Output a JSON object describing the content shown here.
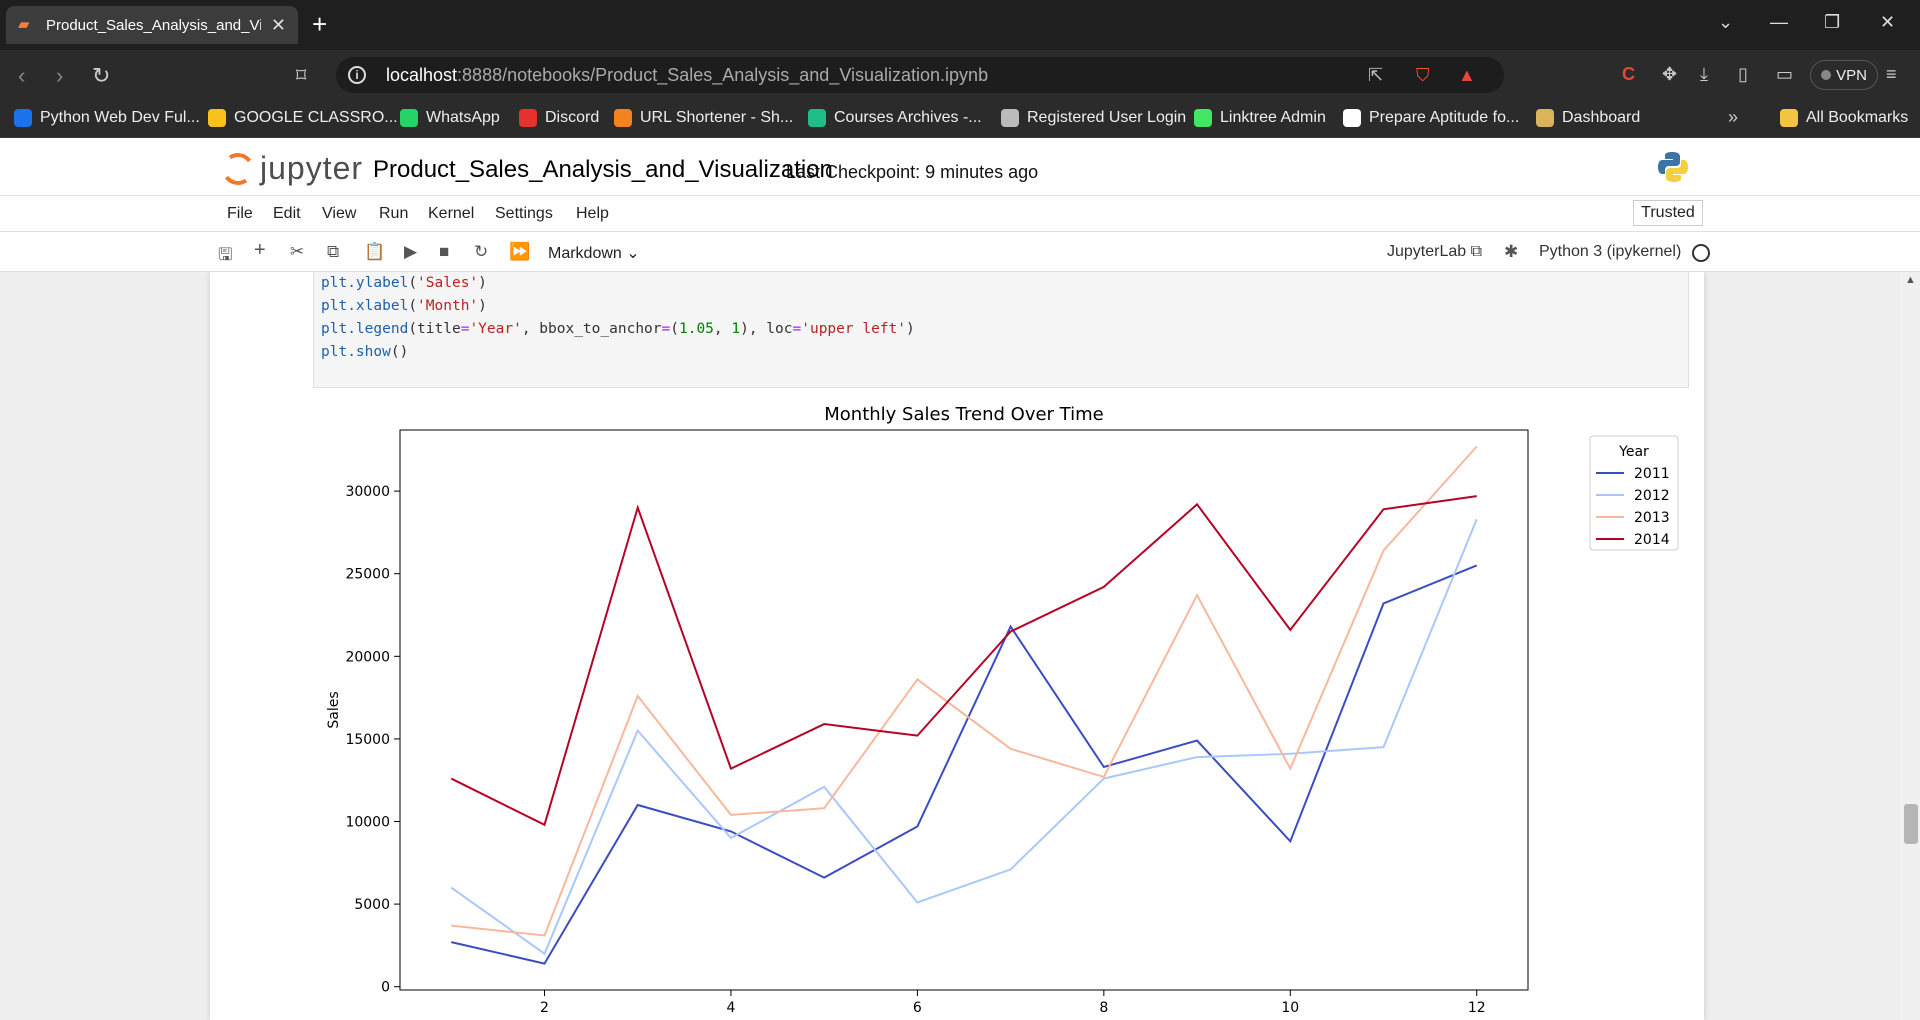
{
  "browser": {
    "tab_title": "Product_Sales_Analysis_and_Vis",
    "url_host": "localhost",
    "url_rest": ":8888/notebooks/Product_Sales_Analysis_and_Visualization.ipynb",
    "vpn_label": "VPN",
    "bookmarks": [
      {
        "label": "Python Web Dev Ful...",
        "icon": "code-icon",
        "color": "#1a73e8"
      },
      {
        "label": "GOOGLE CLASSRO...",
        "icon": "classroom-icon",
        "color": "#f9c11a"
      },
      {
        "label": "WhatsApp",
        "icon": "whatsapp-icon",
        "color": "#25d366"
      },
      {
        "label": "Discord",
        "icon": "discord-icon",
        "color": "#e5322d"
      },
      {
        "label": "URL Shortener - Sh...",
        "icon": "link-icon",
        "color": "#f58220"
      },
      {
        "label": "Courses Archives -...",
        "icon": "courses-icon",
        "color": "#1fbd8a"
      },
      {
        "label": "Registered User Login",
        "icon": "globe-icon",
        "color": "#bbbbbb"
      },
      {
        "label": "Linktree Admin",
        "icon": "linktree-icon",
        "color": "#43e660"
      },
      {
        "label": "Prepare Aptitude fo...",
        "icon": "check-icon",
        "color": "#ffffff"
      },
      {
        "label": "Dashboard",
        "icon": "dashboard-icon",
        "color": "#d9b45a"
      }
    ],
    "all_bookmarks": "All Bookmarks"
  },
  "jupyter": {
    "logo_text": "jupyter",
    "notebook_name": "Product_Sales_Analysis_and_Visualization",
    "checkpoint": "Last Checkpoint: 9 minutes ago",
    "menus": [
      "File",
      "Edit",
      "View",
      "Run",
      "Kernel",
      "Settings",
      "Help"
    ],
    "trusted": "Trusted",
    "cell_type": "Markdown",
    "jupyterlab_label": "JupyterLab",
    "kernel_label": "Python 3 (ipykernel)"
  },
  "code_lines": [
    "plt.ylabel('Sales')",
    "plt.xlabel('Month')",
    "plt.legend(title='Year', bbox_to_anchor=(1.05, 1), loc='upper left')",
    "plt.show()"
  ],
  "chart_data": {
    "type": "line",
    "title": "Monthly Sales Trend Over Time",
    "ylabel": "Sales",
    "xlabel": "",
    "x": [
      1,
      2,
      3,
      4,
      5,
      6,
      7,
      8,
      9,
      10,
      11,
      12
    ],
    "xticks": [
      2,
      4,
      6,
      8,
      10,
      12
    ],
    "yticks": [
      0,
      5000,
      10000,
      15000,
      20000,
      25000,
      30000
    ],
    "xlim": [
      0.45,
      12.55
    ],
    "ylim": [
      -200,
      33700
    ],
    "legend_title": "Year",
    "legend_placement": "outside upper-left",
    "grid": false,
    "series": [
      {
        "name": "2011",
        "color": "#3b4cc0",
        "values": [
          2700,
          1400,
          11000,
          9400,
          6600,
          9700,
          21800,
          13300,
          14900,
          8800,
          23200,
          25500
        ]
      },
      {
        "name": "2012",
        "color": "#aac7fd",
        "values": [
          6000,
          2000,
          15500,
          9000,
          12100,
          5100,
          7100,
          12600,
          13900,
          14100,
          14500,
          28300
        ]
      },
      {
        "name": "2013",
        "color": "#f7b89c",
        "values": [
          3700,
          3100,
          17600,
          10400,
          10800,
          18600,
          14400,
          12700,
          23700,
          13200,
          26400,
          32700
        ]
      },
      {
        "name": "2014",
        "color": "#b40426",
        "values": [
          12600,
          9800,
          29000,
          13200,
          15900,
          15200,
          21500,
          24200,
          29200,
          21600,
          28900,
          29700
        ]
      }
    ]
  }
}
